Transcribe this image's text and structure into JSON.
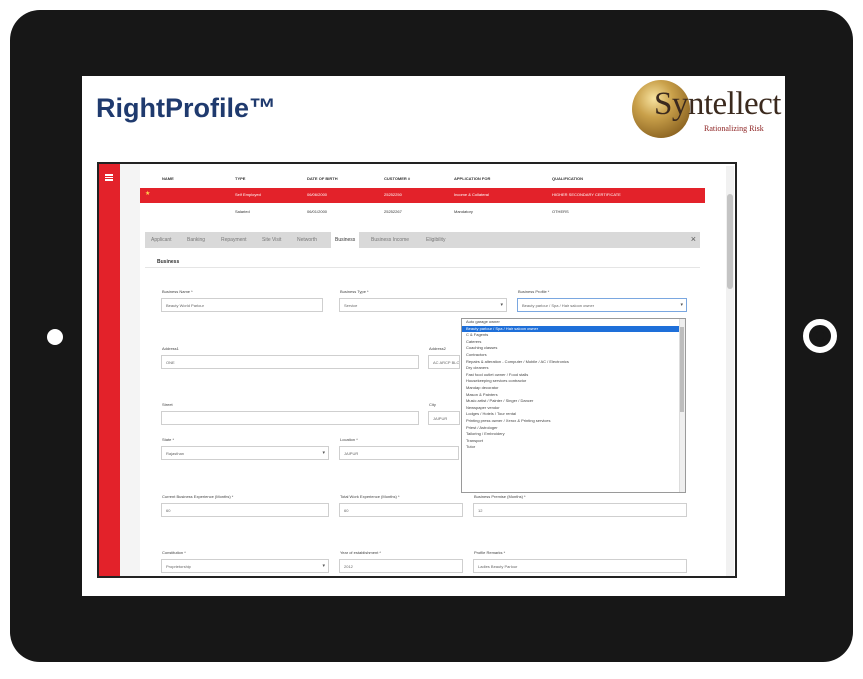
{
  "brand": {
    "title": "RightProfile™"
  },
  "logo": {
    "name": "Syntellect",
    "tagline": "Rationalizing Risk"
  },
  "colors": {
    "accent": "#e3222a",
    "brand": "#1f3a6e",
    "selection": "#1e6fd9"
  },
  "icons": {
    "menu": "hamburger-icon",
    "close": "close-icon",
    "select_arrow": "chevron-down-icon",
    "star": "star-icon"
  },
  "table": {
    "headers": [
      "NAME",
      "TYPE",
      "DATE OF BIRTH",
      "CUSTOMER #",
      "APPLICATION FOR",
      "QUALIFICATION"
    ],
    "rows": [
      {
        "star": "★",
        "name": "",
        "type": "Self Employed",
        "dob": "06/06/2000",
        "customer": "25252250",
        "application": "Income & Collateral",
        "qualification": "HIGHER SECONDARY CERTIFICATE",
        "selected": true
      },
      {
        "star": "",
        "name": "",
        "type": "Salaried",
        "dob": "06/01/2000",
        "customer": "25252267",
        "application": "Mandatory",
        "qualification": "OTHERS",
        "selected": false
      }
    ]
  },
  "tabs": [
    "Applicant",
    "Banking",
    "Repayment",
    "Site Visit",
    "Networth",
    "Business",
    "Business Income",
    "Eligibility"
  ],
  "active_tab": "Business",
  "close_symbol": "×",
  "section": {
    "title": "Business"
  },
  "form": {
    "business_name": {
      "label": "Business Name *",
      "value": "Beauty World Parlour"
    },
    "business_type": {
      "label": "Business Type *",
      "value": "Service"
    },
    "business_profile": {
      "label": "Business Profile *",
      "value": "Beauty parlour / Spa / Hair saloon owner"
    },
    "address1": {
      "label": "Address1",
      "value": "ONE"
    },
    "address2": {
      "label": "Address2",
      "value": "AC ARCP BLOCK"
    },
    "street": {
      "label": "Street",
      "value": ""
    },
    "city": {
      "label": "City",
      "value": "JAIPUR"
    },
    "state": {
      "label": "State *",
      "value": "Rajasthan"
    },
    "location": {
      "label": "Location *",
      "value": "JAIPUR"
    },
    "current_exp": {
      "label": "Current Business Experience (Months) *",
      "value": "60"
    },
    "total_exp": {
      "label": "Total Work Experience (Months) *",
      "value": "60"
    },
    "premise": {
      "label": "Business Premise (Months) *",
      "value": "12"
    },
    "constitution": {
      "label": "Constitution *",
      "value": "Proprietorship"
    },
    "year_est": {
      "label": "Year of establishment *",
      "value": "2012"
    },
    "profile_remarks": {
      "label": "Profile Remarks *",
      "value": "Ladies Beauty Parlour"
    }
  },
  "dropdown": {
    "options": [
      "Auto garage owner",
      "Beauty parlour / Spa / Hair saloon owner",
      "C & Fagents",
      "Caterers",
      "Coaching classes",
      "Contractors",
      "Repairs & alteration - Computer / Mobile / AC / Electronics",
      "Dry cleaners",
      "Fast food outlet owner / Food stalls",
      "Housekeeping services contractor",
      "Mandap decorator",
      "Mason & Painters",
      "Music artist / Painter / Singer / Dancer",
      "Newspaper vendor",
      "Lodges / Hotels / Tour rental",
      "Printing press owner / Xerox & Printing services",
      "Priest / Astrologer",
      "Tailoring / Embroidery",
      "Transport",
      "Tutor"
    ],
    "highlighted_index": 1
  }
}
